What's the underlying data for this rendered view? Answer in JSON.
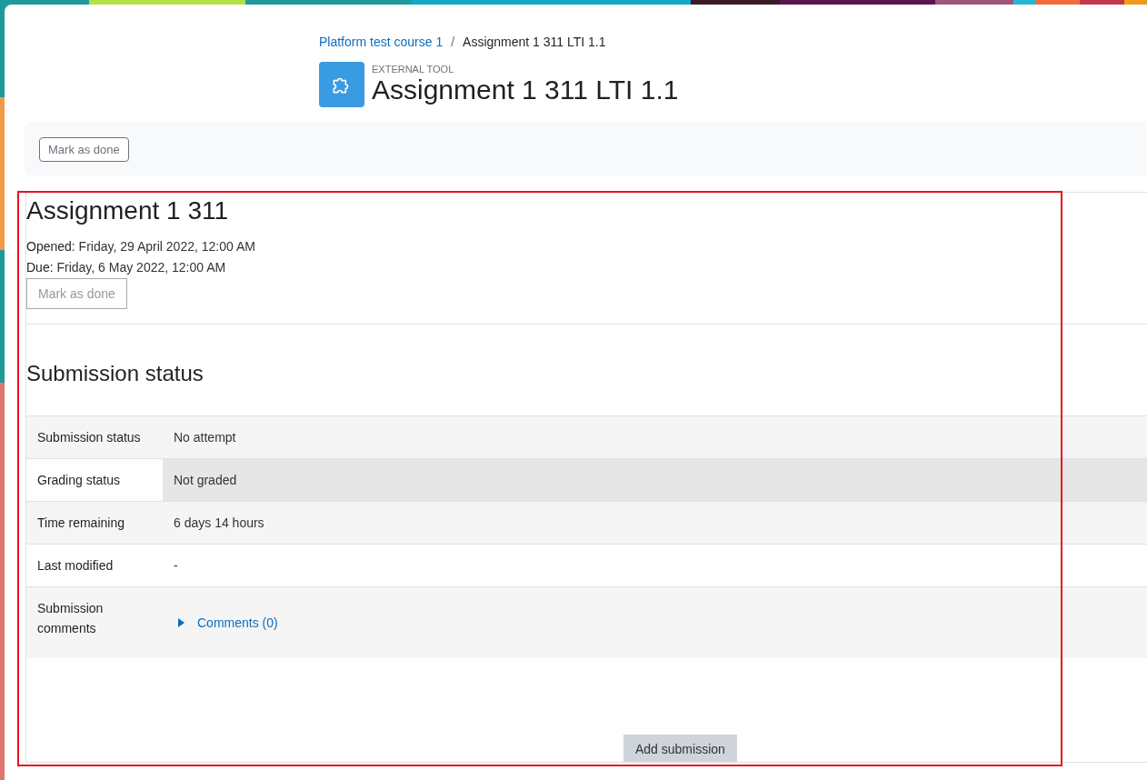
{
  "breadcrumb": [
    {
      "label": "Platform test course 1",
      "kind": "link"
    },
    {
      "label": "/",
      "kind": "separator"
    },
    {
      "label": "Assignment 1 311 LTI 1.1",
      "kind": "current"
    }
  ],
  "header": {
    "kind_label": "EXTERNAL TOOL",
    "title": "Assignment 1 311 LTI 1.1"
  },
  "activity_bar": {
    "button": "Mark as done"
  },
  "embedded": {
    "title": "Assignment 1 311",
    "dates": [
      {
        "label": "Opened:",
        "value": "Friday, 29 April 2022, 12:00 AM"
      },
      {
        "label": "Due:",
        "value": "Friday, 6 May 2022, 12:00 AM"
      }
    ],
    "button": "Mark as done",
    "section_title": "Submission status",
    "rows": [
      {
        "label": "Submission status",
        "value": "No attempt",
        "kind": "text",
        "highlighted": false
      },
      {
        "label": "Grading status",
        "value": "Not graded",
        "kind": "text",
        "highlighted": true
      },
      {
        "label": "Time remaining",
        "value": "6 days 14 hours",
        "kind": "text",
        "highlighted": false
      },
      {
        "label": "Last modified",
        "value": "-",
        "kind": "text",
        "highlighted": false
      },
      {
        "label": "Submission comments",
        "value": "Comments (0)",
        "kind": "link",
        "highlighted": false
      }
    ],
    "submit_button": "Add submission"
  }
}
